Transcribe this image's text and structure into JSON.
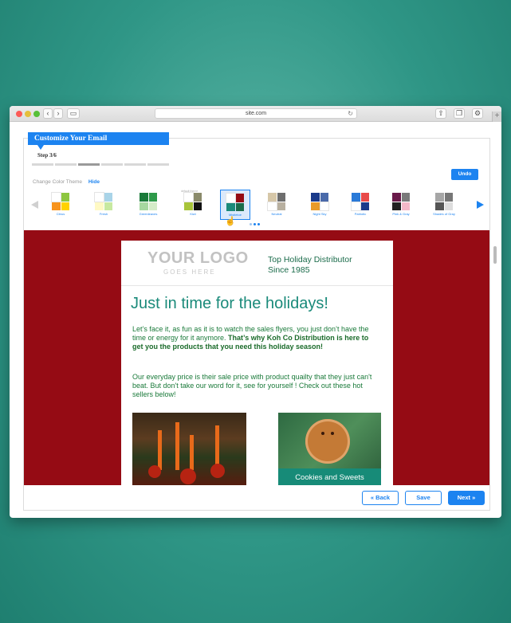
{
  "browser": {
    "url": "site.com",
    "new_tab": "+"
  },
  "wizard": {
    "title": "Customize Your Email",
    "step": "Step 3/6",
    "progress": {
      "current": 3,
      "total": 6
    },
    "change_theme_label": "Change Color Theme",
    "hide_label": "Hide",
    "undo_label": "Undo"
  },
  "themes": [
    {
      "name": "Citrus",
      "colors": [
        "#ffffff",
        "#8dc63f",
        "#f7941d",
        "#ffd200"
      ]
    },
    {
      "name": "Fresh",
      "colors": [
        "#ffffff",
        "#a9d4e8",
        "#fff9c4",
        "#c7e9a0"
      ]
    },
    {
      "name": "Greenleaves",
      "colors": [
        "#1a7a3a",
        "#2e9a4a",
        "#a6d8a0",
        "#d4ecc8"
      ]
    },
    {
      "name": "Kiwi",
      "colors": [
        "#ffffff",
        "#8a8a6a",
        "#a8c43a",
        "#111111"
      ]
    },
    {
      "name": "Mistletoe",
      "colors": [
        "#ffffff",
        "#950b14",
        "#1a8a7a",
        "#1a6b4a"
      ],
      "selected": true
    },
    {
      "name": "Neutral",
      "colors": [
        "#d6c7a8",
        "#6e6e6e",
        "#ffffff",
        "#b8b0a0"
      ]
    },
    {
      "name": "Night Sky",
      "colors": [
        "#1a3a8a",
        "#4a6aaa",
        "#e89a2a",
        "#ffffff"
      ]
    },
    {
      "name": "Patriotic",
      "colors": [
        "#2a7ad8",
        "#e84a4a",
        "#ffffff",
        "#1a3a8a"
      ]
    },
    {
      "name": "Pink & Gray",
      "colors": [
        "#6a1a4a",
        "#7a7a7a",
        "#222222",
        "#f4b8c8"
      ]
    },
    {
      "name": "Shades of Gray",
      "colors": [
        "#a6a6a6",
        "#777777",
        "#555555",
        "#dddddd"
      ]
    }
  ],
  "kiwi_note": "default theme",
  "email": {
    "logo_main": "YOUR LOGO",
    "logo_sub": "GOES HERE",
    "tagline_1": "Top Holiday Distributor",
    "tagline_2": "Since 1985",
    "title": "Just in time for the holidays!",
    "para1_text": "Let’s face it, as fun as it is to watch the sales flyers, you just don’t have the time or energy for it anymore. ",
    "para1_bold": "That’s why Koh Co Distribution is here to get you the products that you need this holiday season!",
    "para2": "Our everyday price is their sale price with product quailty that they just can't beat. But don't take our word for it, see for yourself ! Check out these hot sellers below!",
    "photo_caption": "Cookies and Sweets"
  },
  "footer": {
    "back_label": "« Back",
    "save_label": "Save",
    "next_label": "Next »"
  }
}
